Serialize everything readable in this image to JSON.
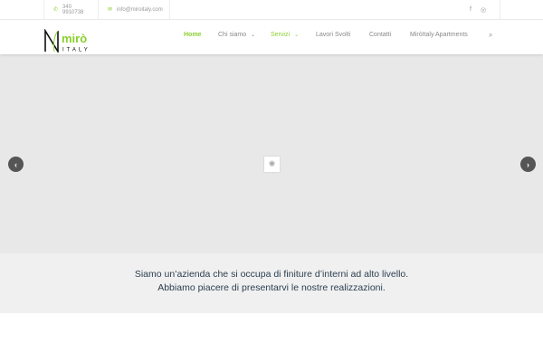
{
  "topbar": {
    "phone": "340 9910738",
    "email": "info@miroitaly.com",
    "social": [
      "facebook-icon",
      "instagram-icon"
    ]
  },
  "logo": {
    "name": "mirò",
    "sub": "ITALY"
  },
  "nav": {
    "items": [
      {
        "label": "Home"
      },
      {
        "label": "Chi siamo"
      },
      {
        "label": "Servizi"
      },
      {
        "label": "Lavori Svolti"
      },
      {
        "label": "Contatti"
      },
      {
        "label": "MiròItaly Apartments"
      }
    ]
  },
  "slider": {
    "prev": "‹",
    "next": "›"
  },
  "intro": {
    "line1": "Siamo un’azienda che si occupa di finiture d’interni ad alto livello.",
    "line2": "Abbiamo piacere di presentarvi le nostre realizzazioni."
  },
  "colors": {
    "accent": "#8ad02c",
    "text": "#2c3e50"
  }
}
